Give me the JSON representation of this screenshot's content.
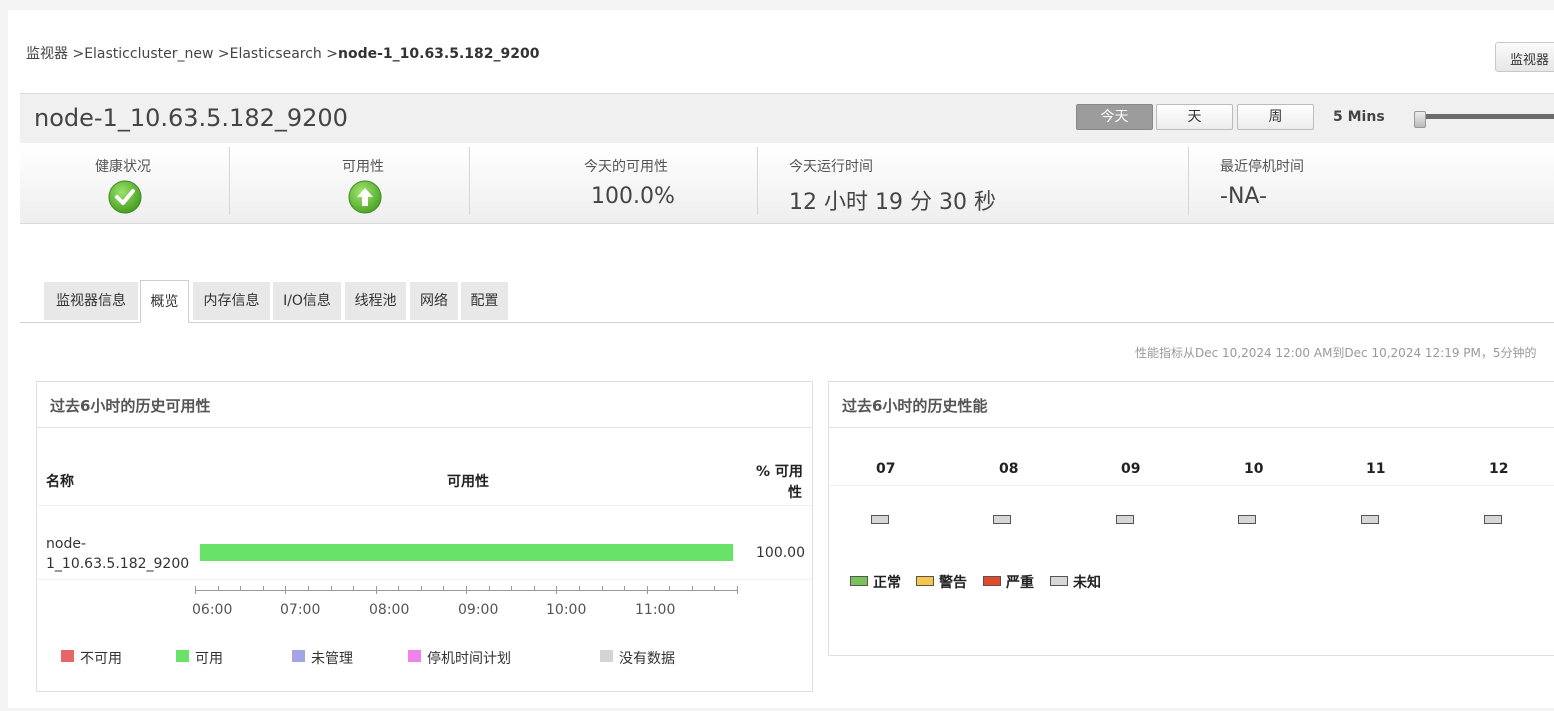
{
  "breadcrumb": {
    "part1": "监视器 >",
    "part2": "Elasticcluster_new >",
    "part3": "Elasticsearch >",
    "current": "node-1_10.63.5.182_9200"
  },
  "header": {
    "monitor_btn": "监视器",
    "title": "node-1_10.63.5.182_9200"
  },
  "period": {
    "today": "今天",
    "day": "天",
    "week": "周",
    "interval": "5 Mins"
  },
  "stats": {
    "health_label": "健康状况",
    "availability_label": "可用性",
    "today_availability_label": "今天的可用性",
    "today_availability_value": "100.0%",
    "uptime_label": "今天运行时间",
    "uptime_value": "12 小时 19 分 30 秒",
    "last_down_label": "最近停机时间",
    "last_down_value": "-NA-"
  },
  "tabs": [
    "监视器信息",
    "概览",
    "内存信息",
    "I/O信息",
    "线程池",
    "网络",
    "配置"
  ],
  "perf_note": "性能指标从Dec 10,2024 12:00 AM到Dec 10,2024 12:19 PM，5分钟的",
  "availability_panel": {
    "title": "过去6小时的历史可用性",
    "col_name": "名称",
    "col_availability": "可用性",
    "col_pct_1": "% 可用",
    "col_pct_2": "性",
    "row_name_1": "node-",
    "row_name_2": "1_10.63.5.182_9200",
    "row_pct": "100.00",
    "axis": [
      "06:00",
      "07:00",
      "08:00",
      "09:00",
      "10:00",
      "11:00"
    ],
    "legend": {
      "unavailable": "不可用",
      "available": "可用",
      "unmanaged": "未管理",
      "scheduled_downtime": "停机时间计划",
      "no_data": "没有数据"
    }
  },
  "performance_panel": {
    "title": "过去6小时的历史性能",
    "hours": [
      "07",
      "08",
      "09",
      "10",
      "11",
      "12"
    ],
    "legend": {
      "normal": "正常",
      "warning": "警告",
      "critical": "严重",
      "unknown": "未知"
    }
  },
  "colors": {
    "available": "#68e269",
    "unavailable": "#e86565",
    "unmanaged": "#a3a3e6",
    "scheduled": "#ee82ee",
    "no_data": "#d4d4d4",
    "normal": "#77c35a",
    "warning": "#f4c64f",
    "critical": "#e14a2c",
    "unknown": "#d7d7d7"
  }
}
